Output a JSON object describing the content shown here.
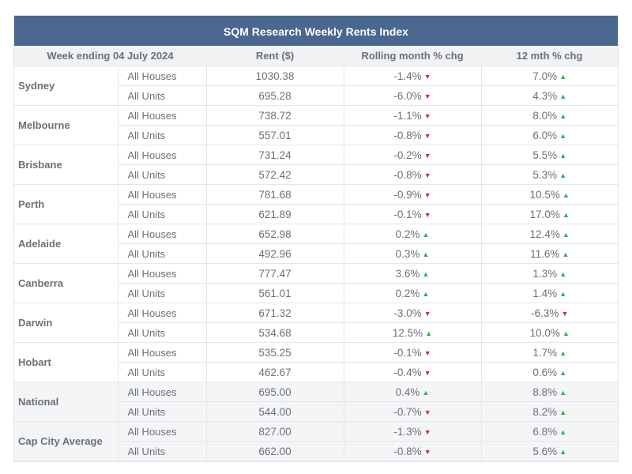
{
  "title": "SQM Research Weekly Rents Index",
  "colors": {
    "header_bg": "#4a6790",
    "up": "#2fb14a",
    "down": "#d92b2b",
    "shaded_row": "#f4f5f7"
  },
  "headers": [
    "Week ending 04 July 2024",
    "Rent ($)",
    "Rolling month % chg",
    "12 mth % chg"
  ],
  "rows": [
    {
      "city": "Sydney",
      "shaded": false,
      "items": [
        {
          "type": "All Houses",
          "rent": "1030.38",
          "month": "-1.4%",
          "month_dir": "down",
          "year": "7.0%",
          "year_dir": "up"
        },
        {
          "type": "All Units",
          "rent": "695.28",
          "month": "-6.0%",
          "month_dir": "down",
          "year": "4.3%",
          "year_dir": "up"
        }
      ]
    },
    {
      "city": "Melbourne",
      "shaded": false,
      "items": [
        {
          "type": "All Houses",
          "rent": "738.72",
          "month": "-1.1%",
          "month_dir": "down",
          "year": "8.0%",
          "year_dir": "up"
        },
        {
          "type": "All Units",
          "rent": "557.01",
          "month": "-0.8%",
          "month_dir": "down",
          "year": "6.0%",
          "year_dir": "up"
        }
      ]
    },
    {
      "city": "Brisbane",
      "shaded": false,
      "items": [
        {
          "type": "All Houses",
          "rent": "731.24",
          "month": "-0.2%",
          "month_dir": "down",
          "year": "5.5%",
          "year_dir": "up"
        },
        {
          "type": "All Units",
          "rent": "572.42",
          "month": "-0.8%",
          "month_dir": "down",
          "year": "5.3%",
          "year_dir": "up"
        }
      ]
    },
    {
      "city": "Perth",
      "shaded": false,
      "items": [
        {
          "type": "All Houses",
          "rent": "781.68",
          "month": "-0.9%",
          "month_dir": "down",
          "year": "10.5%",
          "year_dir": "up"
        },
        {
          "type": "All Units",
          "rent": "621.89",
          "month": "-0.1%",
          "month_dir": "down",
          "year": "17.0%",
          "year_dir": "up"
        }
      ]
    },
    {
      "city": "Adelaide",
      "shaded": false,
      "items": [
        {
          "type": "All Houses",
          "rent": "652.98",
          "month": "0.2%",
          "month_dir": "up",
          "year": "12.4%",
          "year_dir": "up"
        },
        {
          "type": "All Units",
          "rent": "492.96",
          "month": "0.3%",
          "month_dir": "up",
          "year": "11.6%",
          "year_dir": "up"
        }
      ]
    },
    {
      "city": "Canberra",
      "shaded": false,
      "items": [
        {
          "type": "All Houses",
          "rent": "777.47",
          "month": "3.6%",
          "month_dir": "up",
          "year": "1.3%",
          "year_dir": "up"
        },
        {
          "type": "All Units",
          "rent": "561.01",
          "month": "0.2%",
          "month_dir": "up",
          "year": "1.4%",
          "year_dir": "up"
        }
      ]
    },
    {
      "city": "Darwin",
      "shaded": false,
      "items": [
        {
          "type": "All Houses",
          "rent": "671.32",
          "month": "-3.0%",
          "month_dir": "down",
          "year": "-6.3%",
          "year_dir": "down"
        },
        {
          "type": "All Units",
          "rent": "534.68",
          "month": "12.5%",
          "month_dir": "up",
          "year": "10.0%",
          "year_dir": "up"
        }
      ]
    },
    {
      "city": "Hobart",
      "shaded": false,
      "items": [
        {
          "type": "All Houses",
          "rent": "535.25",
          "month": "-0.1%",
          "month_dir": "down",
          "year": "1.7%",
          "year_dir": "up"
        },
        {
          "type": "All Units",
          "rent": "462.67",
          "month": "-0.4%",
          "month_dir": "down",
          "year": "0.6%",
          "year_dir": "up"
        }
      ]
    },
    {
      "city": "National",
      "shaded": true,
      "items": [
        {
          "type": "All Houses",
          "rent": "695.00",
          "month": "0.4%",
          "month_dir": "up",
          "year": "8.8%",
          "year_dir": "up"
        },
        {
          "type": "All Units",
          "rent": "544.00",
          "month": "-0.7%",
          "month_dir": "down",
          "year": "8.2%",
          "year_dir": "up"
        }
      ]
    },
    {
      "city": "Cap City Average",
      "shaded": true,
      "items": [
        {
          "type": "All Houses",
          "rent": "827.00",
          "month": "-1.3%",
          "month_dir": "down",
          "year": "6.8%",
          "year_dir": "up"
        },
        {
          "type": "All Units",
          "rent": "662.00",
          "month": "-0.8%",
          "month_dir": "down",
          "year": "5.6%",
          "year_dir": "up"
        }
      ]
    }
  ]
}
